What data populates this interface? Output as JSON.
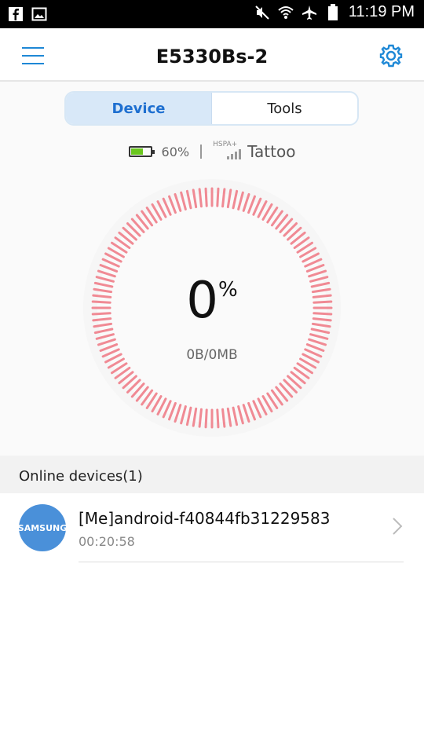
{
  "statusbar": {
    "time": "11:19 PM",
    "left_icons": [
      "facebook-icon",
      "image-icon"
    ],
    "right_icons": [
      "mute-icon",
      "wifi-icon",
      "airplane-icon",
      "battery-icon"
    ]
  },
  "header": {
    "title": "E5330Bs-2",
    "menu_icon": "menu-icon",
    "settings_icon": "gear-icon",
    "accent": "#1e88d6"
  },
  "tabs": [
    {
      "label": "Device",
      "active": true
    },
    {
      "label": "Tools",
      "active": false
    }
  ],
  "status": {
    "battery_percent": "60%",
    "battery_level": 0.6,
    "network_type": "HSPA+",
    "carrier": "Tattoo"
  },
  "usage": {
    "percent": "0",
    "percent_symbol": "%",
    "used_total": "0B/0MB",
    "gauge_color": "#f08a94"
  },
  "online_devices": {
    "header": "Online devices(1)",
    "items": [
      {
        "avatar_label": "SAMSUNG",
        "name": "[Me]android-f40844fb31229583",
        "duration": "00:20:58"
      }
    ]
  }
}
